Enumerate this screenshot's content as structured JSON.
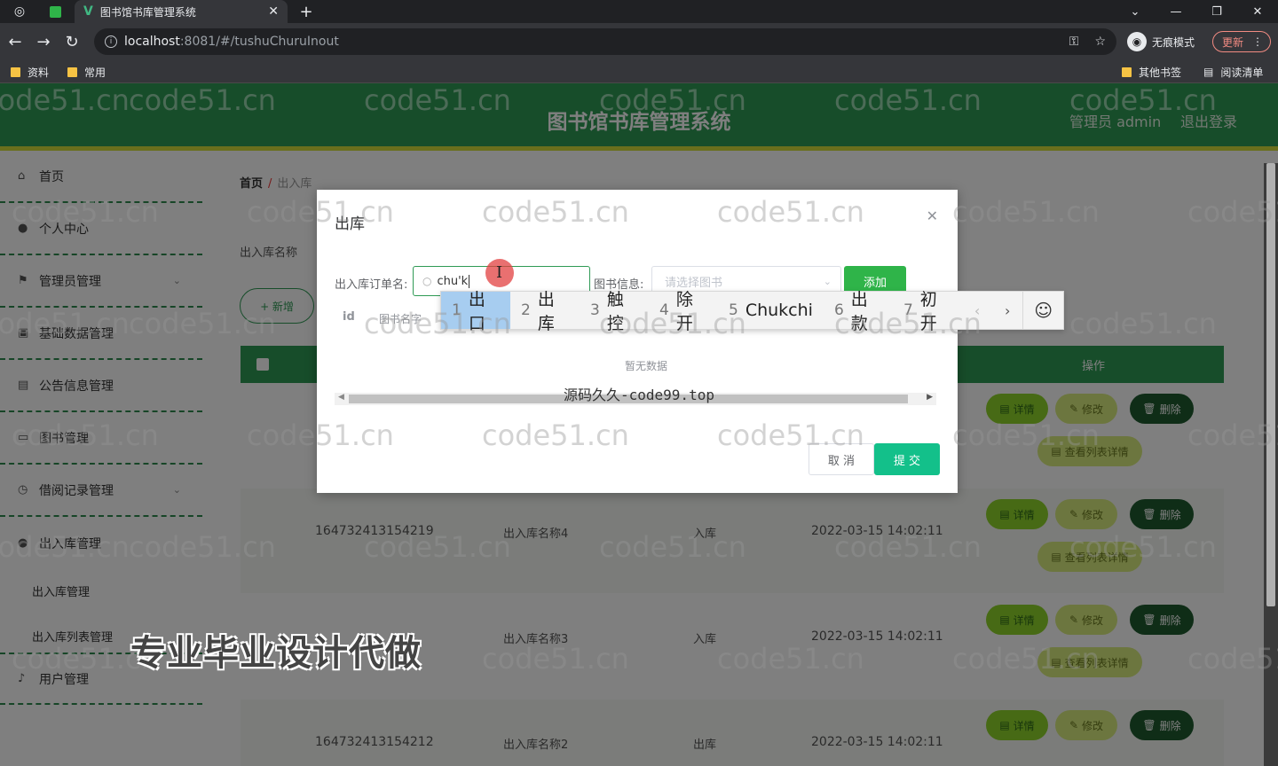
{
  "browser": {
    "tab_title": "图书馆书库管理系统",
    "url_host": "localhost",
    "url_path": ":8081/#/tushuChuruInout",
    "incognito_label": "无痕模式",
    "update_label": "更新",
    "bookmarks_left": [
      "资料",
      "常用"
    ],
    "bookmarks_right": [
      "其他书签",
      "阅读清单"
    ]
  },
  "header": {
    "title": "图书馆书库管理系统",
    "user": "管理员 admin",
    "logout": "退出登录"
  },
  "sidebar": {
    "items": [
      {
        "label": "首页",
        "icon": "home-icon"
      },
      {
        "label": "个人中心",
        "icon": "user-icon"
      },
      {
        "label": "管理员管理",
        "icon": "flag-icon"
      },
      {
        "label": "基础数据管理",
        "icon": "image-icon"
      },
      {
        "label": "公告信息管理",
        "icon": "file-icon"
      },
      {
        "label": "图书管理",
        "icon": "folder-icon"
      },
      {
        "label": "借阅记录管理",
        "icon": "clock-icon"
      },
      {
        "label": "出入库管理",
        "icon": "user-icon"
      }
    ],
    "sub_items": [
      "出入库管理",
      "出入库列表管理"
    ],
    "last_item": {
      "label": "用户管理",
      "icon": "mic-icon"
    }
  },
  "main": {
    "breadcrumb_home": "首页",
    "breadcrumb_current": "出入库",
    "search_label": "出入库名称",
    "add_button": "+ 新增",
    "op_header": "操作",
    "rows": [
      {
        "code": "",
        "name": "",
        "type": "",
        "time": ""
      },
      {
        "code": "164732413154219",
        "name": "出入库名称4",
        "type": "入库",
        "time": "2022-03-15 14:02:11"
      },
      {
        "code": "",
        "name": "出入库名称3",
        "type": "入库",
        "time": "2022-03-15 14:02:11"
      },
      {
        "code": "164732413154212",
        "name": "出入库名称2",
        "type": "出库",
        "time": "2022-03-15 14:02:11"
      }
    ],
    "actions": {
      "detail": "详情",
      "edit": "修改",
      "delete": "删除",
      "list_detail": "查看列表详情"
    }
  },
  "dialog": {
    "title": "出库",
    "order_label": "出入库订单名:",
    "order_value": "chu'k",
    "book_label": "图书信息:",
    "book_placeholder": "请选择图书",
    "add_button": "添加",
    "col_id": "id",
    "col_name": "图书名字",
    "empty_text": "暂无数据",
    "cancel_button": "取 消",
    "submit_button": "提 交"
  },
  "ime": {
    "candidates": [
      {
        "n": "1",
        "text": "出口"
      },
      {
        "n": "2",
        "text": "出库"
      },
      {
        "n": "3",
        "text": "触控"
      },
      {
        "n": "4",
        "text": "除开"
      },
      {
        "n": "5",
        "text": "Chukchi"
      },
      {
        "n": "6",
        "text": "出款"
      },
      {
        "n": "7",
        "text": "初开"
      }
    ]
  },
  "watermarks": {
    "site": "code51.cn",
    "code99": "源码久久-code99.top",
    "banner": "专业毕业设计代做"
  },
  "colors": {
    "header_green": "#2f9a55",
    "accent_yellow": "#d5df38",
    "submit_teal": "#13c08a",
    "add_green": "#2fb449"
  }
}
